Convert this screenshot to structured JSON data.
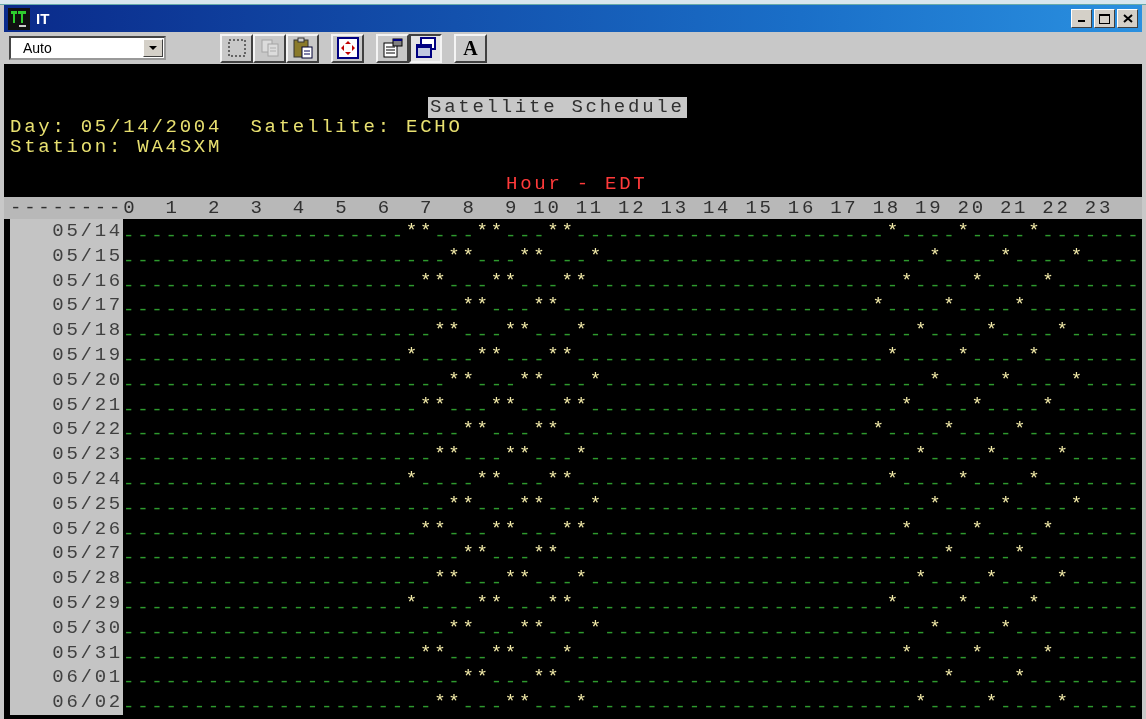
{
  "window": {
    "title": "IT"
  },
  "toolbar": {
    "dropdown": {
      "value": "Auto"
    },
    "groups": [
      [
        {
          "kind": "select",
          "disabled": false,
          "pressed": false
        },
        {
          "kind": "copy",
          "disabled": true,
          "pressed": false
        },
        {
          "kind": "paste",
          "disabled": false,
          "pressed": false
        }
      ],
      [
        {
          "kind": "fullscreen",
          "disabled": false,
          "pressed": false
        }
      ],
      [
        {
          "kind": "properties",
          "disabled": false,
          "pressed": false
        },
        {
          "kind": "background",
          "disabled": false,
          "pressed": true
        }
      ],
      [
        {
          "kind": "font",
          "label": "A",
          "disabled": false,
          "pressed": false
        }
      ]
    ]
  },
  "terminal": {
    "heading": "Satellite Schedule",
    "day": "Day: 05/14/2004",
    "satellite": "Satellite: ECHO",
    "station": "Station: WA4SXM",
    "axis_title": "Hour - EDT",
    "hour_scale": "--------0  1  2  3  4  5  6  7  8  9 10 11 12 13 14 15 16 17 18 19 20 21 22 23",
    "rows": [
      {
        "date": "05/14",
        "line": "--------------------**---**---**----------------------*----*----*-------"
      },
      {
        "date": "05/15",
        "line": "-----------------------**---**---*-----------------------*----*----*----"
      },
      {
        "date": "05/16",
        "line": "---------------------**---**---**----------------------*----*----*------"
      },
      {
        "date": "05/17",
        "line": "------------------------**---**----------------------*----*----*--------"
      },
      {
        "date": "05/18",
        "line": "----------------------**---**---*-----------------------*----*----*-----"
      },
      {
        "date": "05/19",
        "line": "--------------------*----**---**----------------------*----*----*-------"
      },
      {
        "date": "05/20",
        "line": "-----------------------**---**---*-----------------------*----*----*----"
      },
      {
        "date": "05/21",
        "line": "---------------------**---**---**----------------------*----*----*------"
      },
      {
        "date": "05/22",
        "line": "------------------------**---**----------------------*----*----*--------"
      },
      {
        "date": "05/23",
        "line": "----------------------**---**---*-----------------------*----*----*-----"
      },
      {
        "date": "05/24",
        "line": "--------------------*----**---**----------------------*----*----*-------"
      },
      {
        "date": "05/25",
        "line": "-----------------------**---**---*-----------------------*----*----*----"
      },
      {
        "date": "05/26",
        "line": "---------------------**---**---**----------------------*----*----*------"
      },
      {
        "date": "05/27",
        "line": "------------------------**---**---------------------------*----*--------"
      },
      {
        "date": "05/28",
        "line": "----------------------**---**---*-----------------------*----*----*-----"
      },
      {
        "date": "05/29",
        "line": "--------------------*----**---**----------------------*----*----*-------"
      },
      {
        "date": "05/30",
        "line": "-----------------------**---**---*-----------------------*----*---------"
      },
      {
        "date": "05/31",
        "line": "---------------------**---**---*-----------------------*----*----*------"
      },
      {
        "date": "06/01",
        "line": "------------------------**---**---------------------------*----*--------"
      },
      {
        "date": "06/02",
        "line": "----------------------**---**---*-----------------------*----*----*-----"
      }
    ]
  }
}
